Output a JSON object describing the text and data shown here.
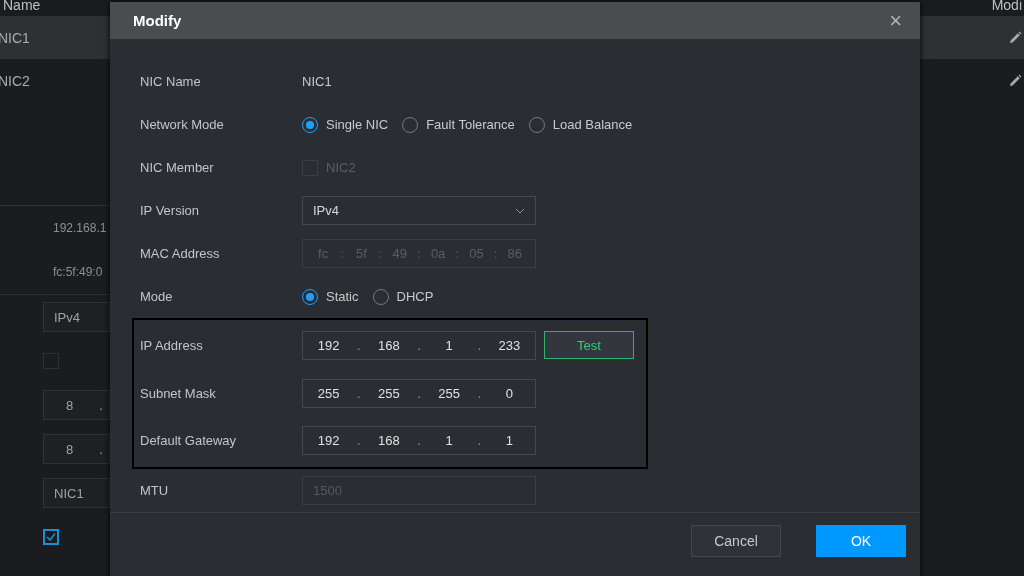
{
  "page": {
    "columns": [
      "Name",
      "Modi"
    ],
    "rows": [
      {
        "name": "NIC1",
        "selected": true
      },
      {
        "name": "NIC2",
        "selected": false
      }
    ],
    "details": [
      {
        "kind": "text",
        "value": "192.168.1"
      },
      {
        "kind": "text",
        "value": "fc:5f:49:0"
      },
      {
        "kind": "field",
        "value": "IPv4"
      },
      {
        "kind": "checkbox",
        "checked": false
      },
      {
        "kind": "ip",
        "value": "8",
        "separator": "."
      },
      {
        "kind": "ip",
        "value": "8",
        "separator": "."
      },
      {
        "kind": "field",
        "value": "NIC1"
      },
      {
        "kind": "checkbox",
        "checked": true
      }
    ]
  },
  "dialog": {
    "title": "Modify",
    "close": "×",
    "sections": [
      {
        "outlined": false,
        "fields": [
          {
            "kind": "text",
            "label": "NIC Name",
            "value": "NIC1"
          },
          {
            "kind": "radio",
            "label": "Network Mode",
            "options": [
              {
                "label": "Single NIC",
                "selected": true
              },
              {
                "label": "Fault Tolerance",
                "selected": false
              },
              {
                "label": "Load Balance",
                "selected": false
              }
            ]
          },
          {
            "kind": "checkbox",
            "label": "NIC Member",
            "disabled": true,
            "options": [
              {
                "label": "NIC2",
                "checked": false
              }
            ]
          },
          {
            "kind": "select",
            "label": "IP Version",
            "value": "IPv4"
          },
          {
            "kind": "segments",
            "label": "MAC Address",
            "disabled": true,
            "separator": ":",
            "segments": [
              "fc",
              "5f",
              "49",
              "0a",
              "05",
              "86"
            ]
          },
          {
            "kind": "radio",
            "label": "Mode",
            "options": [
              {
                "label": "Static",
                "selected": true
              },
              {
                "label": "DHCP",
                "selected": false
              }
            ]
          }
        ]
      },
      {
        "outlined": true,
        "fields": [
          {
            "kind": "segments",
            "label": "IP Address",
            "disabled": false,
            "separator": ".",
            "segments": [
              "192",
              "168",
              "1",
              "233"
            ],
            "action": "Test"
          },
          {
            "kind": "segments",
            "label": "Subnet Mask",
            "disabled": false,
            "separator": ".",
            "segments": [
              "255",
              "255",
              "255",
              "0"
            ]
          },
          {
            "kind": "segments",
            "label": "Default Gateway",
            "disabled": false,
            "separator": ".",
            "segments": [
              "192",
              "168",
              "1",
              "1"
            ]
          }
        ]
      },
      {
        "outlined": false,
        "fields": [
          {
            "kind": "input",
            "label": "MTU",
            "disabled": true,
            "value": "1500"
          }
        ]
      }
    ],
    "buttons": [
      {
        "label": "Cancel",
        "kind": "secondary"
      },
      {
        "label": "OK",
        "kind": "primary"
      }
    ]
  }
}
